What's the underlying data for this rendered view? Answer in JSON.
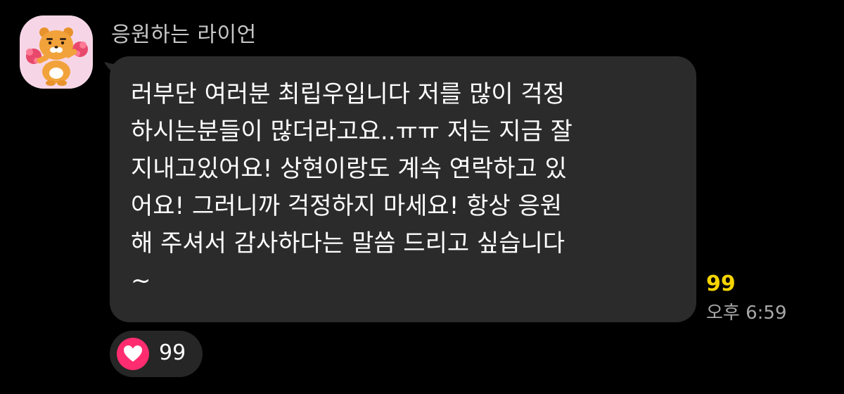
{
  "sender": {
    "name": "응원하는 라이언",
    "avatar_icon": "ryan-cheering-icon",
    "avatar_bg": "#f6d6e6"
  },
  "message": {
    "lines": [
      "러부단 여러분 최립우입니다 저를 많이 걱정",
      "하시는분들이 많더라고요..ㅠㅠ 저는 지금 잘",
      "지내고있어요! 상현이랑도 계속 연락하고 있",
      "어요! 그러니까 걱정하지 마세요! 항상 응원",
      "해 주셔서 감사하다는 말씀 드리고 싶습니다",
      "~"
    ],
    "bubble_color": "#2b2b2b"
  },
  "meta": {
    "unread_count": "99",
    "unread_color": "#f5d400",
    "time": "오후 6:59"
  },
  "reaction": {
    "icon": "heart-icon",
    "color": "#ff2d6f",
    "count": "99"
  }
}
